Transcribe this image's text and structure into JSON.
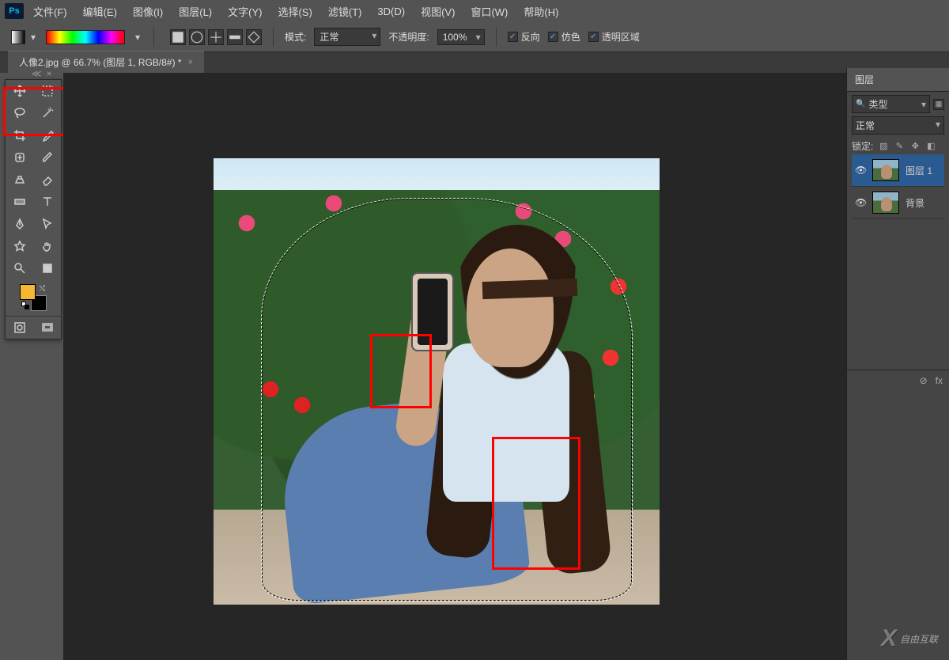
{
  "menu": {
    "items": [
      "文件(F)",
      "编辑(E)",
      "图像(I)",
      "图层(L)",
      "文字(Y)",
      "选择(S)",
      "滤镜(T)",
      "3D(D)",
      "视图(V)",
      "窗口(W)",
      "帮助(H)"
    ]
  },
  "options": {
    "mode_label": "模式:",
    "mode_value": "正常",
    "opacity_label": "不透明度:",
    "opacity_value": "100%",
    "reverse_label": "反向",
    "dither_label": "仿色",
    "transparency_label": "透明区域"
  },
  "doc_tab": {
    "title": "人像2.jpg @ 66.7% (图层 1, RGB/8#) *"
  },
  "tool_header": {
    "label": "≪",
    "close": "×"
  },
  "colors": {
    "fg": "#f7b733",
    "bg": "#000000"
  },
  "layers_panel": {
    "title": "图层",
    "search_label": "类型",
    "blend_mode": "正常",
    "lock_label": "锁定:",
    "layers": [
      {
        "name": "图层 1",
        "selected": true,
        "visible": true
      },
      {
        "name": "背景",
        "selected": false,
        "visible": true
      }
    ],
    "footer": {
      "link": "⊘",
      "fx": "fx"
    }
  },
  "watermark": {
    "brand": "自由互联"
  }
}
